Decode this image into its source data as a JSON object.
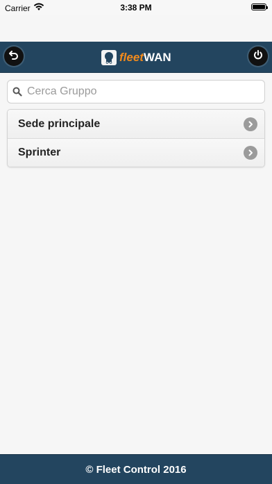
{
  "status_bar": {
    "carrier": "Carrier",
    "time": "3:38 PM",
    "icons": [
      "wifi-icon",
      "battery-icon"
    ]
  },
  "header": {
    "logo_fleet": "fleet",
    "logo_wan": "WAN",
    "back_icon": "back-icon",
    "power_icon": "power-icon",
    "background_color": "#23455f",
    "logo_accent_color": "#f08a1d"
  },
  "search": {
    "placeholder": "Cerca Gruppo",
    "value": "",
    "icon": "search-icon"
  },
  "groups": [
    {
      "label": "Sede principale",
      "icon": "chevron-right-icon"
    },
    {
      "label": "Sprinter",
      "icon": "chevron-right-icon"
    }
  ],
  "footer": {
    "text": "© Fleet Control 2016"
  }
}
